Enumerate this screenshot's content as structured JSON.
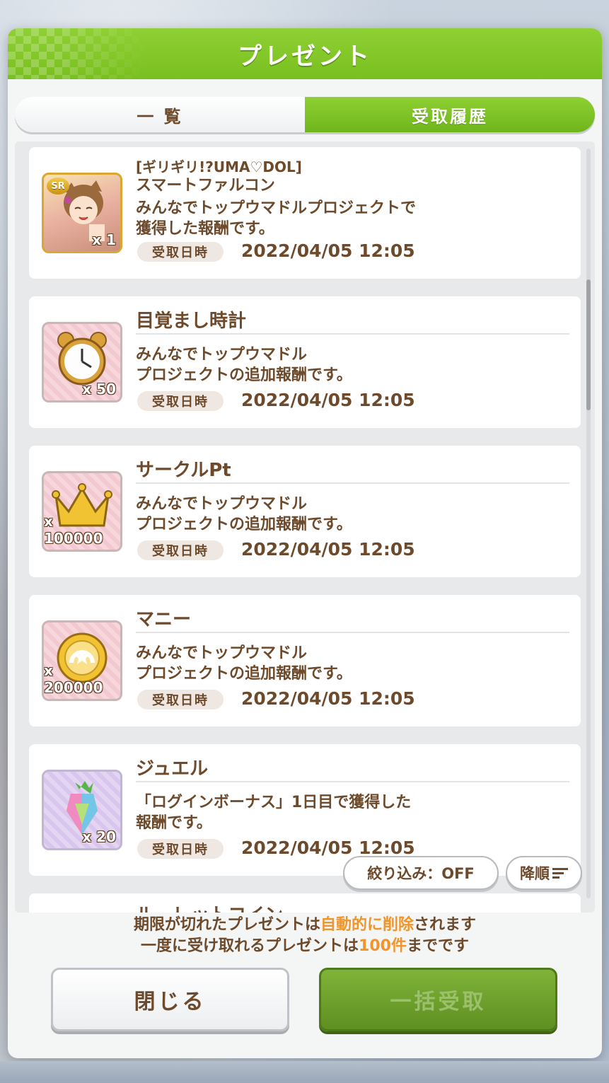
{
  "dialog": {
    "title": "プレゼント"
  },
  "tabs": [
    {
      "label": "一 覧",
      "active": false
    },
    {
      "label": "受取履歴",
      "active": true
    }
  ],
  "items": [
    {
      "name_line1": "[ギリギリ!?UMA♡DOL]",
      "name_line2": "スマートファルコン",
      "icon": "support-card-icon",
      "rarity": "SR",
      "qty": "x 1",
      "desc_line1": "みんなでトップウマドルプロジェクトで",
      "desc_line2": "獲得した報酬です。",
      "date_label": "受取日時",
      "date": "2022/04/05 12:05"
    },
    {
      "name": "目覚まし時計",
      "icon": "alarm-clock-icon",
      "qty": "x 50",
      "desc_line1": "みんなでトップウマドル",
      "desc_line2": "プロジェクトの追加報酬です。",
      "date_label": "受取日時",
      "date": "2022/04/05 12:05"
    },
    {
      "name": "サークルPt",
      "icon": "crown-icon",
      "qty": "x 100000",
      "desc_line1": "みんなでトップウマドル",
      "desc_line2": "プロジェクトの追加報酬です。",
      "date_label": "受取日時",
      "date": "2022/04/05 12:05"
    },
    {
      "name": "マニー",
      "icon": "money-coin-icon",
      "qty": "x 200000",
      "desc_line1": "みんなでトップウマドル",
      "desc_line2": "プロジェクトの追加報酬です。",
      "date_label": "受取日時",
      "date": "2022/04/05 12:05"
    },
    {
      "name": "ジュエル",
      "icon": "jewel-icon",
      "qty": "x 20",
      "desc_line1": "「ログインボーナス」1日目で獲得した",
      "desc_line2": "報酬です。",
      "date_label": "受取日時",
      "date": "2022/04/05 12:05"
    },
    {
      "name": "ルーレットコイン"
    }
  ],
  "filter": {
    "label": "絞り込み：OFF",
    "sort_label": "降順"
  },
  "notes": {
    "line1_a": "期限が切れたプレゼントは",
    "line1_hl": "自動的に削除",
    "line1_b": "されます",
    "line2_a": "一度に受け取れるプレゼントは",
    "line2_hl": "100件",
    "line2_b": "までです"
  },
  "buttons": {
    "close": "閉じる",
    "claim_all": "一括受取"
  },
  "colors": {
    "accent_green": "#79bf1f",
    "text_brown": "#6c4a2b",
    "highlight_orange": "#f0952b"
  }
}
